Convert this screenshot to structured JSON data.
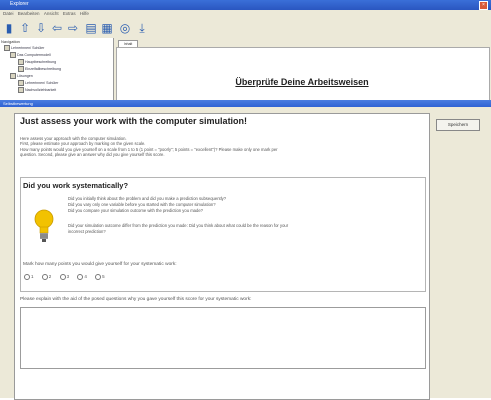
{
  "window": {
    "title": "Explorer",
    "menu": [
      "Datei",
      "Bearbeiten",
      "Ansicht",
      "Extras",
      "Hilfe"
    ]
  },
  "toolbar": {
    "icons": [
      "book-icon",
      "up-arrow-icon",
      "down-arrow-icon",
      "back-arrow-icon",
      "forward-arrow-icon",
      "layout-icon",
      "list-icon",
      "help-icon",
      "download-icon"
    ]
  },
  "nav": {
    "label": "Navigation",
    "items": [
      "Lehrerinnen/ Schüler",
      "Das Computermodell",
      "Hauptbeschreibung",
      "Einzelfallbeschreibung",
      "Lösungen",
      "Lehrerinnen/ Schüler",
      "Nachvollziehbarkeit"
    ]
  },
  "content": {
    "tab_label": "Inhalt",
    "page_title": "Überprüfe Deine Arbeitsweisen"
  },
  "dialog": {
    "title": "Selbstbewertung",
    "ok_label": "Speichern",
    "heading": "Just assess your work with the computer simulation!",
    "intro": [
      "Here assess your approach with the computer simulation.",
      "First, please estimate your approach by marking on the given scale.",
      "How many points would you give yourself on a scale from 1 to 5 (1 point = \"poorly\"; 5 points = \"excellent\")? Please make only one mark per",
      "question. Second, please give an answer why did you give yourself this score."
    ],
    "section_title": "Did you work systematically?",
    "questions": [
      "Did you initially think about the problem and did you make a prediction subsequently?",
      "Did you vary only one variable before you started with the computer simulation?",
      "Did you compare your simulation outcome with the prediction you made?"
    ],
    "question_extra": [
      "Did your simulation outcome differ from the prediction you made: Did you think about what could be the reason for your",
      "incorrect prediction?"
    ],
    "mark_prompt": "Mark how many points you would give yourself for your systematic work:",
    "radio_options": [
      "1",
      "2",
      "3",
      "4",
      "5"
    ],
    "explain_prompt": "Please explain with the aid of the posed questions why you gave yourself this score for your systematic work:"
  },
  "colors": {
    "titlebar": "#2f62d4",
    "dialog_bg": "#ece9d8",
    "bulb": "#f2c200"
  }
}
